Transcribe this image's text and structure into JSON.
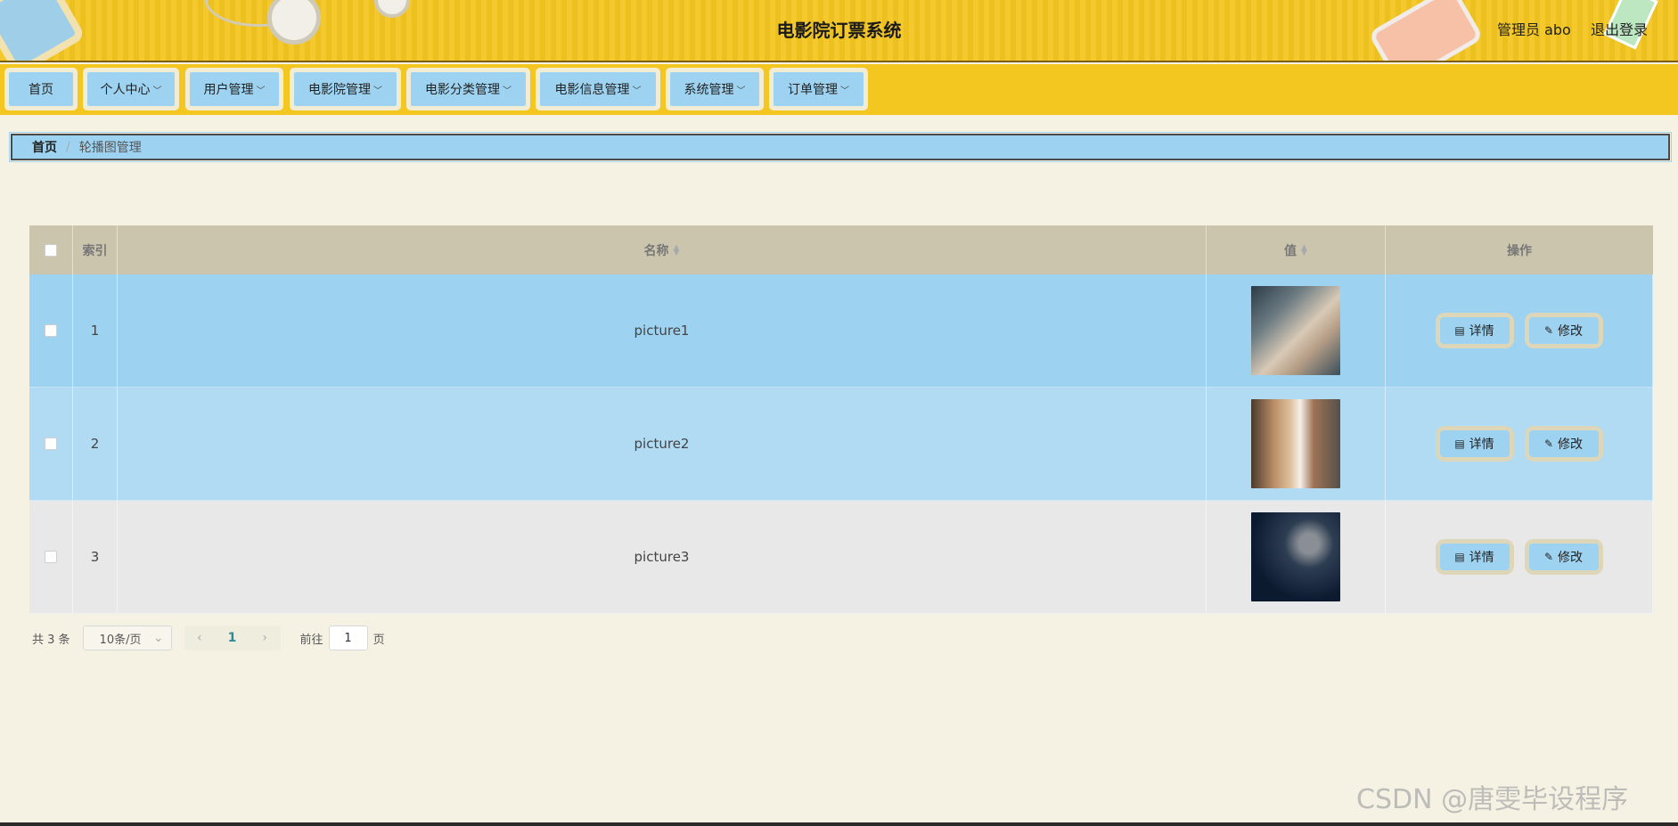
{
  "header": {
    "title": "电影院订票系统",
    "user": "管理员 abo",
    "logout": "退出登录"
  },
  "nav": [
    {
      "label": "首页",
      "dropdown": false
    },
    {
      "label": "个人中心",
      "dropdown": true
    },
    {
      "label": "用户管理",
      "dropdown": true
    },
    {
      "label": "电影院管理",
      "dropdown": true
    },
    {
      "label": "电影分类管理",
      "dropdown": true
    },
    {
      "label": "电影信息管理",
      "dropdown": true
    },
    {
      "label": "系统管理",
      "dropdown": true
    },
    {
      "label": "订单管理",
      "dropdown": true
    }
  ],
  "breadcrumb": {
    "home": "首页",
    "separator": "/",
    "current": "轮播图管理"
  },
  "table": {
    "headers": {
      "index": "索引",
      "name": "名称",
      "value": "值",
      "ops": "操作"
    },
    "rows": [
      {
        "index": "1",
        "name": "picture1"
      },
      {
        "index": "2",
        "name": "picture2"
      },
      {
        "index": "3",
        "name": "picture3"
      }
    ],
    "detail_label": "详情",
    "edit_label": "修改"
  },
  "pager": {
    "total": "共 3 条",
    "page_size": "10条/页",
    "current_page": "1",
    "goto_prefix": "前往",
    "goto_value": "1",
    "goto_suffix": "页"
  },
  "watermark": "CSDN @唐雯毕设程序",
  "colors": {
    "header_bg": "#f4c620",
    "accent_blue": "#9dd3f1",
    "page_bg": "#f5f2e4"
  }
}
